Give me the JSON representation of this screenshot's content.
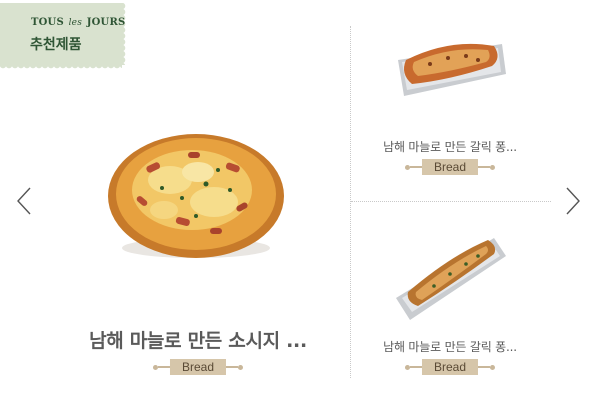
{
  "stamp": {
    "brand_part1": "TOUS",
    "brand_part2": "les",
    "brand_part3": "JOURS",
    "title": "추천제품"
  },
  "navigation": {
    "prev_icon": "chevron-left-icon",
    "next_icon": "chevron-right-icon"
  },
  "products": {
    "main": {
      "name": "남해 마늘로 만든 소시지 ...",
      "category": "Bread"
    },
    "side1": {
      "name": "남해 마늘로 만든 갈릭 퐁...",
      "category": "Bread"
    },
    "side2": {
      "name": "남해 마늘로 만든 갈릭 퐁...",
      "category": "Bread"
    }
  },
  "colors": {
    "stamp_bg": "#d9e2cf",
    "stamp_text": "#2f5535",
    "tag_bg": "#d6c6aa",
    "name_text": "#5a5a5a"
  }
}
